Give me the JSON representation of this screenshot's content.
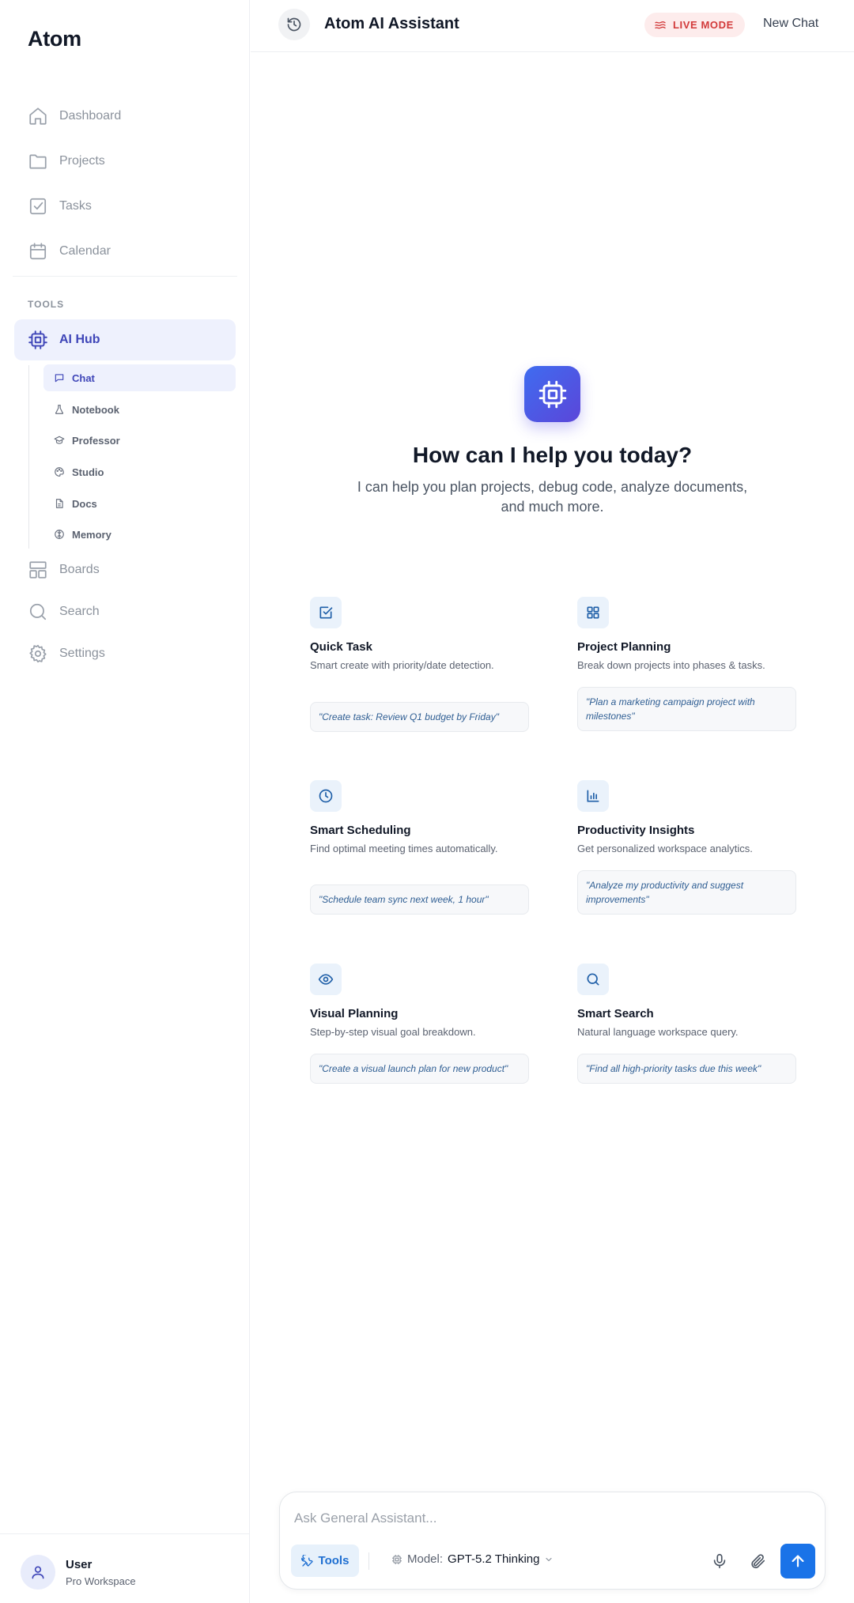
{
  "sidebar": {
    "brand": "Atom",
    "nav": [
      {
        "label": "Dashboard",
        "icon": "home-icon"
      },
      {
        "label": "Projects",
        "icon": "folder-icon"
      },
      {
        "label": "Tasks",
        "icon": "checkbox-icon"
      },
      {
        "label": "Calendar",
        "icon": "calendar-icon"
      }
    ],
    "tools_label": "TOOLS",
    "ai_hub": {
      "label": "AI Hub",
      "icon": "cpu-icon"
    },
    "ai_sub": [
      {
        "label": "Chat",
        "icon": "chat-icon",
        "active": true
      },
      {
        "label": "Notebook",
        "icon": "flask-icon"
      },
      {
        "label": "Professor",
        "icon": "graduation-cap-icon"
      },
      {
        "label": "Studio",
        "icon": "palette-icon"
      },
      {
        "label": "Docs",
        "icon": "document-icon"
      },
      {
        "label": "Memory",
        "icon": "brain-icon"
      }
    ],
    "nav2": [
      {
        "label": "Boards",
        "icon": "boards-icon"
      },
      {
        "label": "Search",
        "icon": "search-icon"
      },
      {
        "label": "Settings",
        "icon": "gear-icon"
      }
    ],
    "user": {
      "name": "User",
      "workspace": "Pro Workspace"
    }
  },
  "header": {
    "title": "Atom AI Assistant",
    "live_badge": "LIVE MODE",
    "new_chat": "New Chat"
  },
  "hero": {
    "title": "How can I help you today?",
    "subtitle": "I can help you plan projects, debug code, analyze documents, and much more."
  },
  "cards": [
    {
      "title": "Quick Task",
      "desc": "Smart create with priority/date detection.",
      "example": "\"Create task: Review Q1 budget by Friday\"",
      "icon": "check-square-icon"
    },
    {
      "title": "Project Planning",
      "desc": "Break down projects into phases & tasks.",
      "example": "\"Plan a marketing campaign project with milestones\"",
      "icon": "grid-icon"
    },
    {
      "title": "Smart Scheduling",
      "desc": "Find optimal meeting times automatically.",
      "example": "\"Schedule team sync next week, 1 hour\"",
      "icon": "clock-icon"
    },
    {
      "title": "Productivity Insights",
      "desc": "Get personalized workspace analytics.",
      "example": "\"Analyze my productivity and suggest improvements\"",
      "icon": "bar-chart-icon"
    },
    {
      "title": "Visual Planning",
      "desc": "Step-by-step visual goal breakdown.",
      "example": "\"Create a visual launch plan for new product\"",
      "icon": "eye-icon"
    },
    {
      "title": "Smart Search",
      "desc": "Natural language workspace query.",
      "example": "\"Find all high-priority tasks due this week\"",
      "icon": "search-icon"
    }
  ],
  "composer": {
    "placeholder": "Ask General Assistant...",
    "tools_label": "Tools",
    "model_prefix": "Model:",
    "model_name": "GPT-5.2 Thinking"
  },
  "colors": {
    "accent": "#1a73e8",
    "indigo": "#3f46b8",
    "live": "#d23a3a"
  }
}
